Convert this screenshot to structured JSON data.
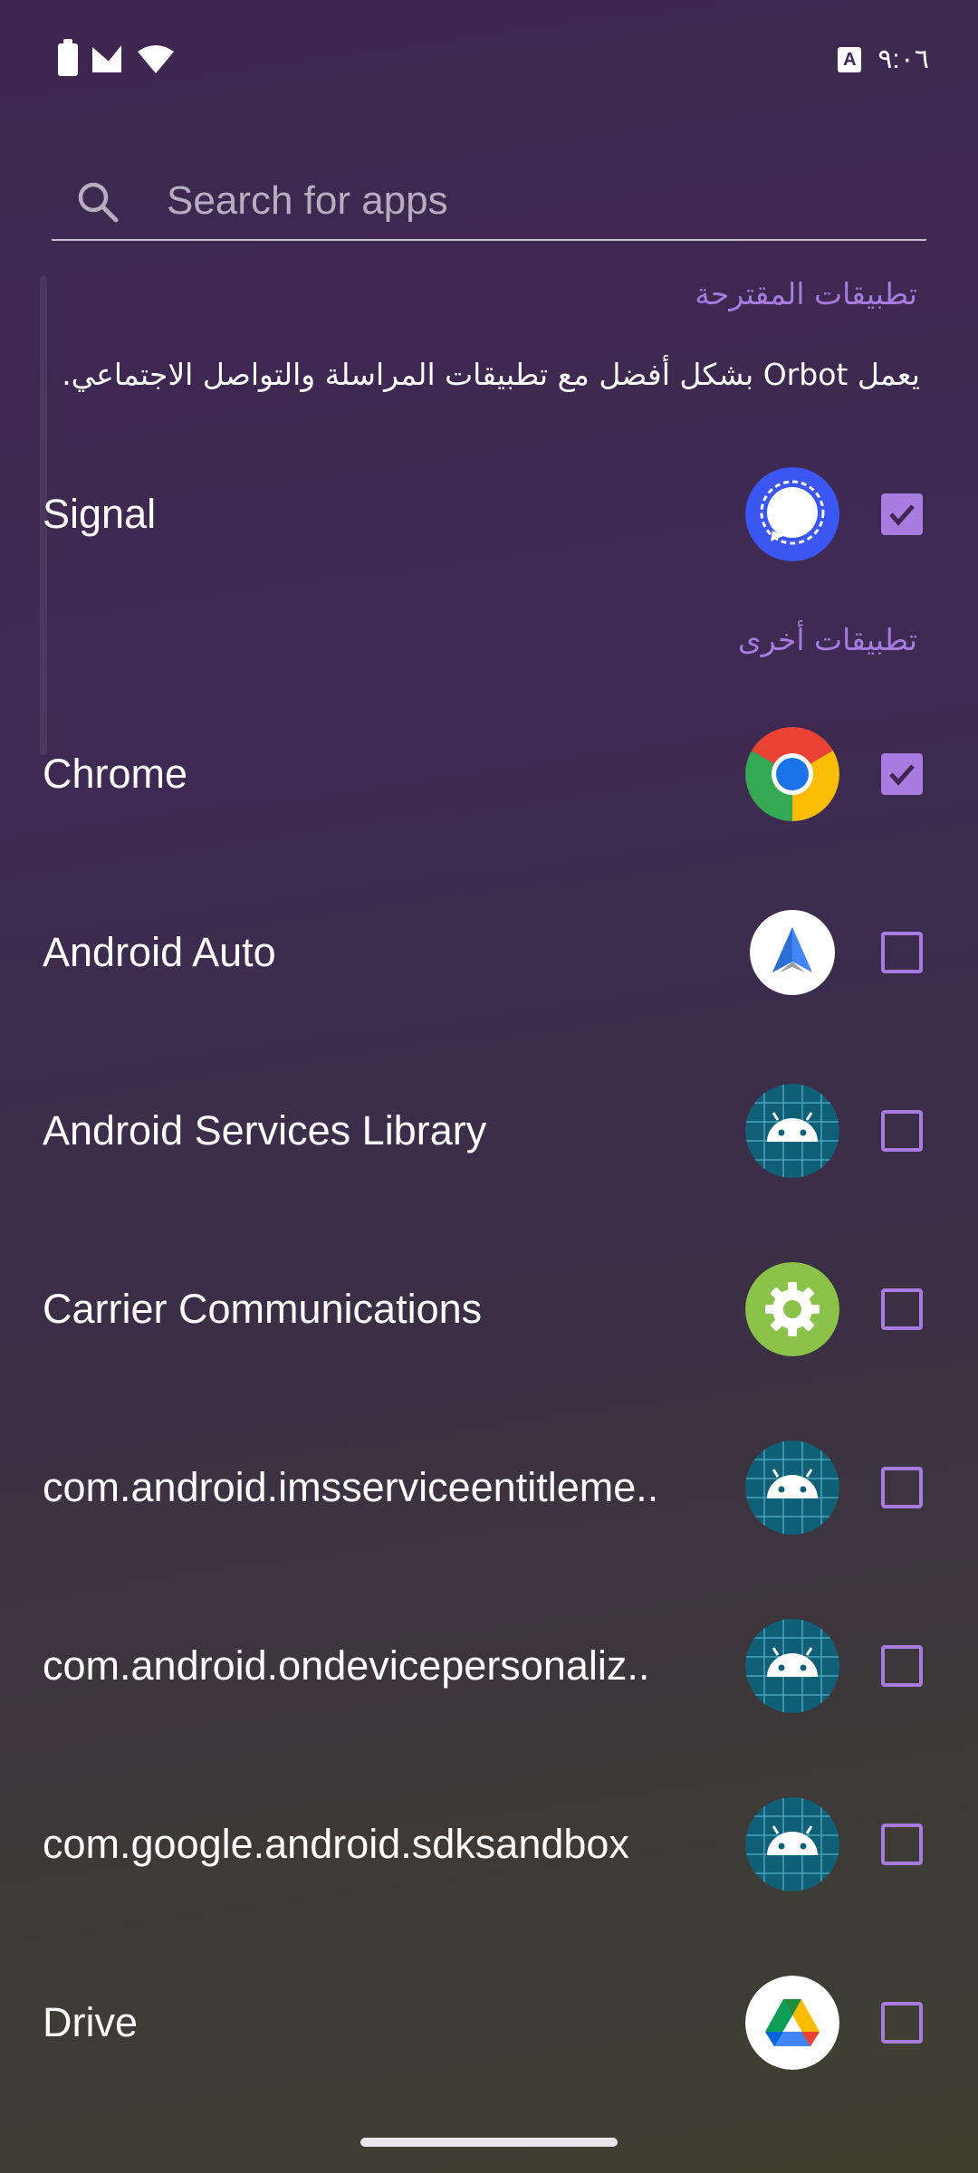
{
  "status_bar": {
    "time": "٩:٠٦",
    "icons": [
      "battery-icon",
      "signal-icon",
      "wifi-icon",
      "accessibility-icon"
    ]
  },
  "search": {
    "placeholder": "Search for apps",
    "value": ""
  },
  "suggested": {
    "title": "تطبيقات المقترحة",
    "description": "يعمل Orbot بشكل أفضل مع تطبيقات المراسلة والتواصل الاجتماعي.",
    "apps": [
      {
        "name": "Signal",
        "icon": "signal-app-icon",
        "checked": true
      }
    ]
  },
  "others": {
    "title": "تطبيقات أخرى",
    "apps": [
      {
        "name": "Chrome",
        "icon": "chrome-icon",
        "checked": true
      },
      {
        "name": "Android Auto",
        "icon": "android-auto-icon",
        "checked": false
      },
      {
        "name": "Android Services Library",
        "icon": "android-robot-icon",
        "checked": false
      },
      {
        "name": "Carrier Communications",
        "icon": "gear-icon",
        "checked": false
      },
      {
        "name": "com.android.imsserviceentitleme..",
        "icon": "android-robot-icon",
        "checked": false
      },
      {
        "name": "com.android.ondevicepersonaliz..",
        "icon": "android-robot-icon",
        "checked": false
      },
      {
        "name": "com.google.android.sdksandbox",
        "icon": "android-robot-icon",
        "checked": false
      },
      {
        "name": "Drive",
        "icon": "drive-icon",
        "checked": false
      }
    ]
  },
  "colors": {
    "accent": "#a77be0",
    "background_top": "#3d2750",
    "background_bottom": "#3f4030",
    "text": "#ffffff"
  }
}
